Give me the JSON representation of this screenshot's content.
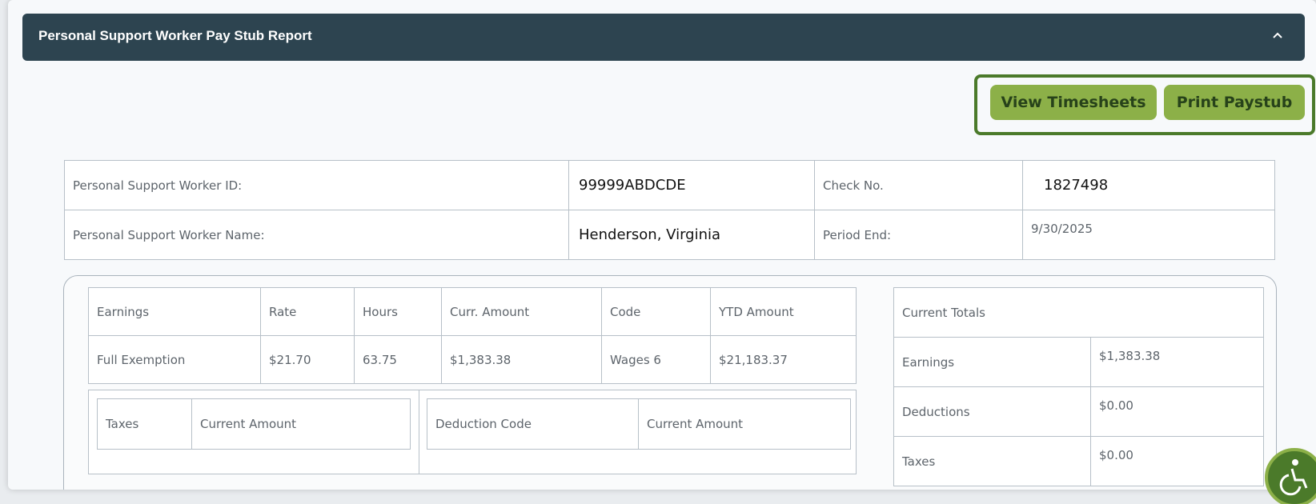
{
  "header": {
    "title": "Personal Support Worker Pay Stub Report",
    "collapse_icon": "chevron-up-icon"
  },
  "actions": {
    "view_timesheets": "View Timesheets",
    "print_paystub": "Print Paystub"
  },
  "worker": {
    "id_label": "Personal Support Worker ID:",
    "id_value": "99999ABDCDE",
    "check_label": "Check No.",
    "check_value": "1827498",
    "name_label": "Personal Support Worker Name:",
    "name_value": "Henderson, Virginia",
    "period_label": "Period End:",
    "period_value": "9/30/2025"
  },
  "earnings": {
    "headers": [
      "Earnings",
      "Rate",
      "Hours",
      "Curr. Amount",
      "Code",
      "YTD Amount"
    ],
    "rows": [
      [
        "Full Exemption",
        "$21.70",
        "63.75",
        "$1,383.38",
        "Wages 6",
        "$21,183.37"
      ]
    ]
  },
  "taxes": {
    "headers": [
      "Taxes",
      "Current Amount"
    ]
  },
  "deductions": {
    "headers": [
      "Deduction Code",
      "Current Amount"
    ]
  },
  "totals": {
    "header": "Current Totals",
    "rows": [
      {
        "label": "Earnings",
        "value": "$1,383.38"
      },
      {
        "label": "Deductions",
        "value": "$0.00"
      },
      {
        "label": "Taxes",
        "value": "$0.00"
      }
    ]
  },
  "accessibility_icon": "accessibility-icon",
  "colors": {
    "header_bg": "#2d4450",
    "button_bg": "#8cb048",
    "button_border": "#4b7a2a"
  }
}
